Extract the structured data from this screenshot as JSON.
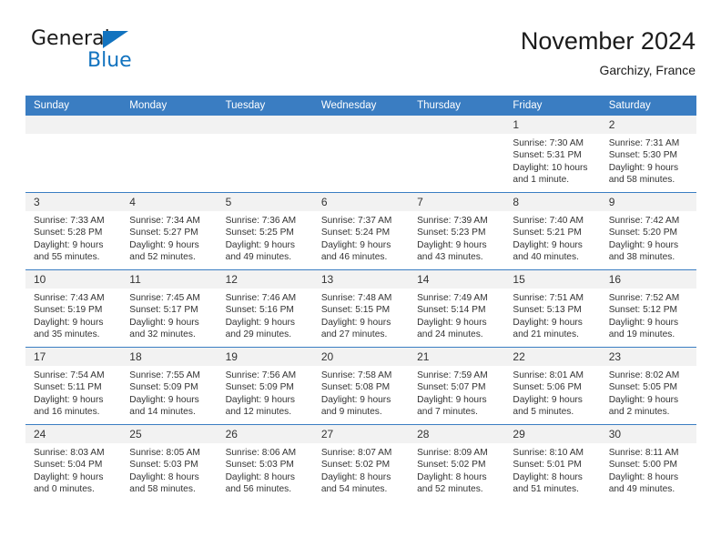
{
  "brand": {
    "name_part1": "General",
    "name_part2": "Blue",
    "mark": "triangle-logo"
  },
  "header": {
    "title": "November 2024",
    "location": "Garchizy, France"
  },
  "calendar": {
    "weekday_headers": [
      "Sunday",
      "Monday",
      "Tuesday",
      "Wednesday",
      "Thursday",
      "Friday",
      "Saturday"
    ],
    "colors": {
      "header_blue": "#3a7dc2",
      "daynum_band": "#f2f2f2",
      "brand_blue": "#1273bf",
      "text": "#333333"
    },
    "weeks": [
      [
        {
          "day": "",
          "sunrise": "",
          "sunset": "",
          "daylight_line1": "",
          "daylight_line2": "",
          "empty": true
        },
        {
          "day": "",
          "sunrise": "",
          "sunset": "",
          "daylight_line1": "",
          "daylight_line2": "",
          "empty": true
        },
        {
          "day": "",
          "sunrise": "",
          "sunset": "",
          "daylight_line1": "",
          "daylight_line2": "",
          "empty": true
        },
        {
          "day": "",
          "sunrise": "",
          "sunset": "",
          "daylight_line1": "",
          "daylight_line2": "",
          "empty": true
        },
        {
          "day": "",
          "sunrise": "",
          "sunset": "",
          "daylight_line1": "",
          "daylight_line2": "",
          "empty": true
        },
        {
          "day": "1",
          "sunrise": "Sunrise: 7:30 AM",
          "sunset": "Sunset: 5:31 PM",
          "daylight_line1": "Daylight: 10 hours",
          "daylight_line2": "and 1 minute.",
          "empty": false
        },
        {
          "day": "2",
          "sunrise": "Sunrise: 7:31 AM",
          "sunset": "Sunset: 5:30 PM",
          "daylight_line1": "Daylight: 9 hours",
          "daylight_line2": "and 58 minutes.",
          "empty": false
        }
      ],
      [
        {
          "day": "3",
          "sunrise": "Sunrise: 7:33 AM",
          "sunset": "Sunset: 5:28 PM",
          "daylight_line1": "Daylight: 9 hours",
          "daylight_line2": "and 55 minutes.",
          "empty": false
        },
        {
          "day": "4",
          "sunrise": "Sunrise: 7:34 AM",
          "sunset": "Sunset: 5:27 PM",
          "daylight_line1": "Daylight: 9 hours",
          "daylight_line2": "and 52 minutes.",
          "empty": false
        },
        {
          "day": "5",
          "sunrise": "Sunrise: 7:36 AM",
          "sunset": "Sunset: 5:25 PM",
          "daylight_line1": "Daylight: 9 hours",
          "daylight_line2": "and 49 minutes.",
          "empty": false
        },
        {
          "day": "6",
          "sunrise": "Sunrise: 7:37 AM",
          "sunset": "Sunset: 5:24 PM",
          "daylight_line1": "Daylight: 9 hours",
          "daylight_line2": "and 46 minutes.",
          "empty": false
        },
        {
          "day": "7",
          "sunrise": "Sunrise: 7:39 AM",
          "sunset": "Sunset: 5:23 PM",
          "daylight_line1": "Daylight: 9 hours",
          "daylight_line2": "and 43 minutes.",
          "empty": false
        },
        {
          "day": "8",
          "sunrise": "Sunrise: 7:40 AM",
          "sunset": "Sunset: 5:21 PM",
          "daylight_line1": "Daylight: 9 hours",
          "daylight_line2": "and 40 minutes.",
          "empty": false
        },
        {
          "day": "9",
          "sunrise": "Sunrise: 7:42 AM",
          "sunset": "Sunset: 5:20 PM",
          "daylight_line1": "Daylight: 9 hours",
          "daylight_line2": "and 38 minutes.",
          "empty": false
        }
      ],
      [
        {
          "day": "10",
          "sunrise": "Sunrise: 7:43 AM",
          "sunset": "Sunset: 5:19 PM",
          "daylight_line1": "Daylight: 9 hours",
          "daylight_line2": "and 35 minutes.",
          "empty": false
        },
        {
          "day": "11",
          "sunrise": "Sunrise: 7:45 AM",
          "sunset": "Sunset: 5:17 PM",
          "daylight_line1": "Daylight: 9 hours",
          "daylight_line2": "and 32 minutes.",
          "empty": false
        },
        {
          "day": "12",
          "sunrise": "Sunrise: 7:46 AM",
          "sunset": "Sunset: 5:16 PM",
          "daylight_line1": "Daylight: 9 hours",
          "daylight_line2": "and 29 minutes.",
          "empty": false
        },
        {
          "day": "13",
          "sunrise": "Sunrise: 7:48 AM",
          "sunset": "Sunset: 5:15 PM",
          "daylight_line1": "Daylight: 9 hours",
          "daylight_line2": "and 27 minutes.",
          "empty": false
        },
        {
          "day": "14",
          "sunrise": "Sunrise: 7:49 AM",
          "sunset": "Sunset: 5:14 PM",
          "daylight_line1": "Daylight: 9 hours",
          "daylight_line2": "and 24 minutes.",
          "empty": false
        },
        {
          "day": "15",
          "sunrise": "Sunrise: 7:51 AM",
          "sunset": "Sunset: 5:13 PM",
          "daylight_line1": "Daylight: 9 hours",
          "daylight_line2": "and 21 minutes.",
          "empty": false
        },
        {
          "day": "16",
          "sunrise": "Sunrise: 7:52 AM",
          "sunset": "Sunset: 5:12 PM",
          "daylight_line1": "Daylight: 9 hours",
          "daylight_line2": "and 19 minutes.",
          "empty": false
        }
      ],
      [
        {
          "day": "17",
          "sunrise": "Sunrise: 7:54 AM",
          "sunset": "Sunset: 5:11 PM",
          "daylight_line1": "Daylight: 9 hours",
          "daylight_line2": "and 16 minutes.",
          "empty": false
        },
        {
          "day": "18",
          "sunrise": "Sunrise: 7:55 AM",
          "sunset": "Sunset: 5:09 PM",
          "daylight_line1": "Daylight: 9 hours",
          "daylight_line2": "and 14 minutes.",
          "empty": false
        },
        {
          "day": "19",
          "sunrise": "Sunrise: 7:56 AM",
          "sunset": "Sunset: 5:09 PM",
          "daylight_line1": "Daylight: 9 hours",
          "daylight_line2": "and 12 minutes.",
          "empty": false
        },
        {
          "day": "20",
          "sunrise": "Sunrise: 7:58 AM",
          "sunset": "Sunset: 5:08 PM",
          "daylight_line1": "Daylight: 9 hours",
          "daylight_line2": "and 9 minutes.",
          "empty": false
        },
        {
          "day": "21",
          "sunrise": "Sunrise: 7:59 AM",
          "sunset": "Sunset: 5:07 PM",
          "daylight_line1": "Daylight: 9 hours",
          "daylight_line2": "and 7 minutes.",
          "empty": false
        },
        {
          "day": "22",
          "sunrise": "Sunrise: 8:01 AM",
          "sunset": "Sunset: 5:06 PM",
          "daylight_line1": "Daylight: 9 hours",
          "daylight_line2": "and 5 minutes.",
          "empty": false
        },
        {
          "day": "23",
          "sunrise": "Sunrise: 8:02 AM",
          "sunset": "Sunset: 5:05 PM",
          "daylight_line1": "Daylight: 9 hours",
          "daylight_line2": "and 2 minutes.",
          "empty": false
        }
      ],
      [
        {
          "day": "24",
          "sunrise": "Sunrise: 8:03 AM",
          "sunset": "Sunset: 5:04 PM",
          "daylight_line1": "Daylight: 9 hours",
          "daylight_line2": "and 0 minutes.",
          "empty": false
        },
        {
          "day": "25",
          "sunrise": "Sunrise: 8:05 AM",
          "sunset": "Sunset: 5:03 PM",
          "daylight_line1": "Daylight: 8 hours",
          "daylight_line2": "and 58 minutes.",
          "empty": false
        },
        {
          "day": "26",
          "sunrise": "Sunrise: 8:06 AM",
          "sunset": "Sunset: 5:03 PM",
          "daylight_line1": "Daylight: 8 hours",
          "daylight_line2": "and 56 minutes.",
          "empty": false
        },
        {
          "day": "27",
          "sunrise": "Sunrise: 8:07 AM",
          "sunset": "Sunset: 5:02 PM",
          "daylight_line1": "Daylight: 8 hours",
          "daylight_line2": "and 54 minutes.",
          "empty": false
        },
        {
          "day": "28",
          "sunrise": "Sunrise: 8:09 AM",
          "sunset": "Sunset: 5:02 PM",
          "daylight_line1": "Daylight: 8 hours",
          "daylight_line2": "and 52 minutes.",
          "empty": false
        },
        {
          "day": "29",
          "sunrise": "Sunrise: 8:10 AM",
          "sunset": "Sunset: 5:01 PM",
          "daylight_line1": "Daylight: 8 hours",
          "daylight_line2": "and 51 minutes.",
          "empty": false
        },
        {
          "day": "30",
          "sunrise": "Sunrise: 8:11 AM",
          "sunset": "Sunset: 5:00 PM",
          "daylight_line1": "Daylight: 8 hours",
          "daylight_line2": "and 49 minutes.",
          "empty": false
        }
      ]
    ]
  }
}
